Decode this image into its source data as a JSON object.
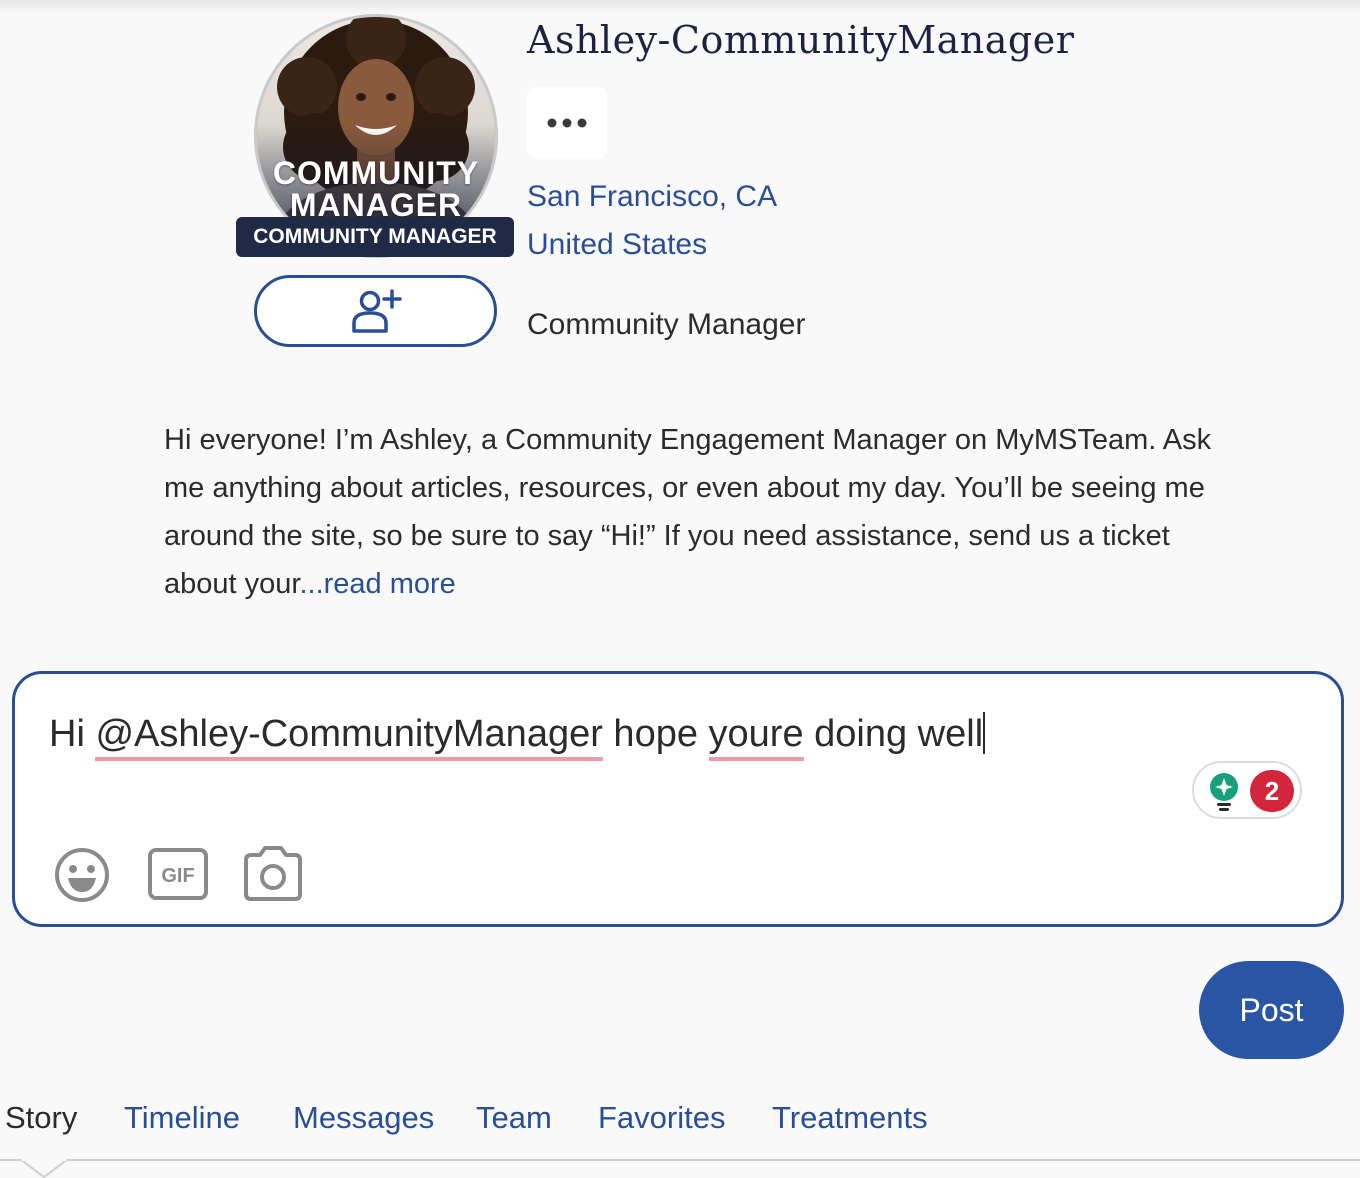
{
  "profile": {
    "username": "Ashley-CommunityManager",
    "avatar_overlay_line1": "COMMUNITY",
    "avatar_overlay_line2": "MANAGER",
    "role_badge": "COMMUNITY MANAGER",
    "location_city": "San Francisco, CA",
    "location_country": "United States",
    "role": "Community Manager",
    "bio": "Hi everyone! I’m Ashley, a Community Engagement Manager on MyMSTeam. Ask me anything about articles, resources, or even about my day. You’ll be seeing me around the site, so be sure to say “Hi!” If you need assistance, send us a ticket about your",
    "read_more": "...read more"
  },
  "composer": {
    "text_prefix": "Hi ",
    "mention": "@Ashley-CommunityManager",
    "text_middle": " hope ",
    "misspelled": "youre",
    "text_suffix": " doing well",
    "grammar_issue_count": "2",
    "post_label": "Post"
  },
  "icons": {
    "follow": "add-user-icon",
    "more": "ellipsis-icon",
    "emoji": "emoji-icon",
    "gif": "gif-icon",
    "camera": "camera-icon",
    "grammar": "lightbulb-icon"
  },
  "tabs": [
    {
      "label": "Story",
      "active": true
    },
    {
      "label": "Timeline"
    },
    {
      "label": "Messages"
    },
    {
      "label": "Team"
    },
    {
      "label": "Favorites"
    },
    {
      "label": "Treatments"
    }
  ],
  "colors": {
    "accent": "#2a4e95",
    "post_button": "#2a55a4",
    "badge_bg": "#202a46",
    "error": "#d3263b"
  }
}
